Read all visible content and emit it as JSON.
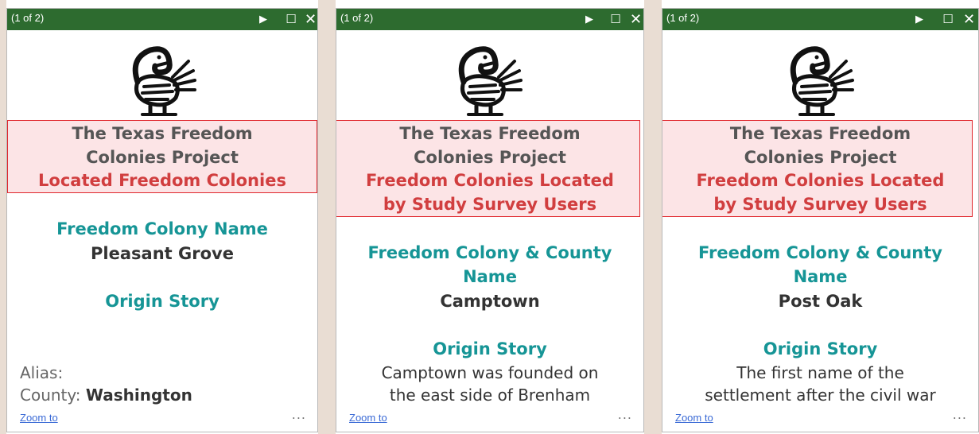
{
  "popups": [
    {
      "count": "(1 of 2)",
      "title_line1": "The Texas Freedom",
      "title_line2": "Colonies Project",
      "subtitle_line1": "Located Freedom Colonies",
      "subtitle_line2": "",
      "name_label_line1": "Freedom Colony Name",
      "name_label_line2": "",
      "name_value": "Pleasant Grove",
      "origin_label": "Origin Story",
      "origin_text_line1": "",
      "origin_text_line2": "",
      "alias_label": "Alias:",
      "county_label": "County:",
      "county_value": "Washington",
      "zoom_label": "Zoom to",
      "more_label": "..."
    },
    {
      "count": "(1 of 2)",
      "title_line1": "The Texas Freedom",
      "title_line2": "Colonies Project",
      "subtitle_line1": "Freedom Colonies Located",
      "subtitle_line2": "by Study Survey Users",
      "name_label_line1": "Freedom Colony & County",
      "name_label_line2": "Name",
      "name_value": "Camptown",
      "origin_label": "Origin Story",
      "origin_text_line1": "Camptown was founded on",
      "origin_text_line2": "the east side of Brenham",
      "zoom_label": "Zoom to",
      "more_label": "..."
    },
    {
      "count": "(1 of 2)",
      "title_line1": "The Texas Freedom",
      "title_line2": "Colonies Project",
      "subtitle_line1": "Freedom Colonies Located",
      "subtitle_line2": "by Study Survey Users",
      "name_label_line1": "Freedom Colony & County",
      "name_label_line2": "Name",
      "name_value": "Post Oak",
      "origin_label": "Origin Story",
      "origin_text_line1": "The first name of the",
      "origin_text_line2": "settlement after the civil war",
      "zoom_label": "Zoom to",
      "more_label": "..."
    }
  ],
  "icons": {
    "next": "play-icon",
    "maximize": "maximize-icon",
    "close": "close-icon",
    "logo": "sankofa-bird-icon"
  },
  "colors": {
    "titlebar": "#2d6b2f",
    "highlight_border": "#e0262c",
    "highlight_fill": "#fce4e6",
    "teal_label": "#169596",
    "red_subtitle": "#d13e3f"
  }
}
